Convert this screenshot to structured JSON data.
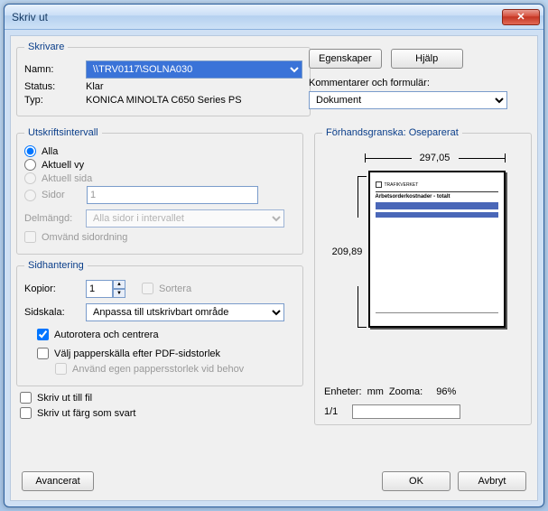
{
  "window": {
    "title": "Skriv ut"
  },
  "printer": {
    "legend": "Skrivare",
    "name_label": "Namn:",
    "name_value": "\\\\TRV0117\\SOLNA030",
    "status_label": "Status:",
    "status_value": "Klar",
    "type_label": "Typ:",
    "type_value": "KONICA MINOLTA C650 Series PS"
  },
  "buttons": {
    "properties": "Egenskaper",
    "help": "Hjälp",
    "ok": "OK",
    "cancel": "Avbryt",
    "advanced": "Avancerat"
  },
  "comments": {
    "label": "Kommentarer och formulär:",
    "value": "Dokument"
  },
  "range": {
    "legend": "Utskriftsintervall",
    "all": "Alla",
    "current_view": "Aktuell vy",
    "current_page": "Aktuell sida",
    "pages": "Sidor",
    "pages_value": "1",
    "subset_label": "Delmängd:",
    "subset_value": "Alla sidor i intervallet",
    "reverse": "Omvänd sidordning"
  },
  "handling": {
    "legend": "Sidhantering",
    "copies_label": "Kopior:",
    "copies_value": "1",
    "collate": "Sortera",
    "scaling_label": "Sidskala:",
    "scaling_value": "Anpassa till utskrivbart område",
    "autorotate": "Autorotera och centrera",
    "paper_source": "Välj papperskälla efter PDF-sidstorlek",
    "custom_size": "Använd egen pappersstorlek vid behov"
  },
  "options": {
    "to_file": "Skriv ut till fil",
    "as_black": "Skriv ut färg som svart"
  },
  "preview": {
    "legend": "Förhandsgranska: Oseparerat",
    "width": "297,05",
    "height": "209,89",
    "units_label": "Enheter:",
    "units_value": "mm",
    "zoom_label": "Zooma:",
    "zoom_value": "96%",
    "page_count": "1/1",
    "doc_brand": "TRAFIKVERKET",
    "doc_title": "Arbetsorderkostnader - totalt"
  }
}
